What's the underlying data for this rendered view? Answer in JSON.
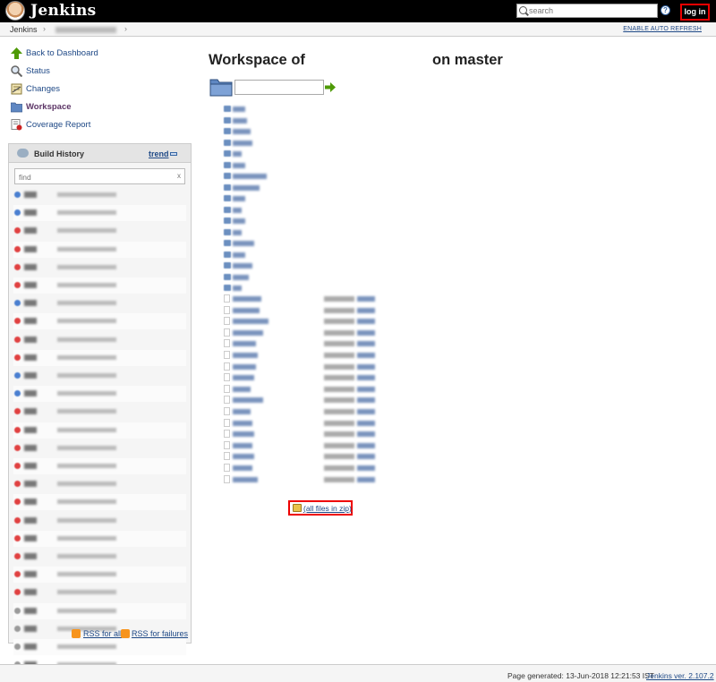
{
  "header": {
    "brand": "Jenkins",
    "search_placeholder": "search",
    "help": "?",
    "login_label": "log in"
  },
  "breadcrumb": {
    "root": "Jenkins",
    "sep": "›",
    "auto_refresh": "ENABLE AUTO REFRESH"
  },
  "tasks": [
    {
      "label": "Back to Dashboard",
      "icon": "up-arrow-icon"
    },
    {
      "label": "Status",
      "icon": "magnifier-icon"
    },
    {
      "label": "Changes",
      "icon": "notepad-icon"
    },
    {
      "label": "Workspace",
      "icon": "folder-icon",
      "current": true
    },
    {
      "label": "Coverage Report",
      "icon": "report-icon"
    }
  ],
  "build_history": {
    "title": "Build History",
    "trend": "trend",
    "find_placeholder": "find",
    "clear": "x",
    "build_status_colors": [
      "blue",
      "blue",
      "red",
      "red",
      "red",
      "red",
      "blue",
      "red",
      "red",
      "red",
      "blue",
      "blue",
      "red",
      "red",
      "red",
      "red",
      "red",
      "red",
      "red",
      "red",
      "red",
      "red",
      "red",
      "grey",
      "grey",
      "grey",
      "grey"
    ],
    "rss_all": "RSS for all",
    "rss_failures": "RSS for failures"
  },
  "main": {
    "title_prefix": "Workspace of",
    "title_suffix": "on master",
    "all_files_zip": "(all files in zip)"
  },
  "footer": {
    "generated": "Page generated: 13-Jun-2018 12:21:53 IST",
    "version": "Jenkins ver. 2.107.2"
  },
  "colors": {
    "header_bg": "#000000",
    "link": "#204a87",
    "highlight_border": "#ee0000",
    "build_blue": "#4a7fd0",
    "build_red": "#e04040",
    "build_grey": "#9a9a9a"
  }
}
